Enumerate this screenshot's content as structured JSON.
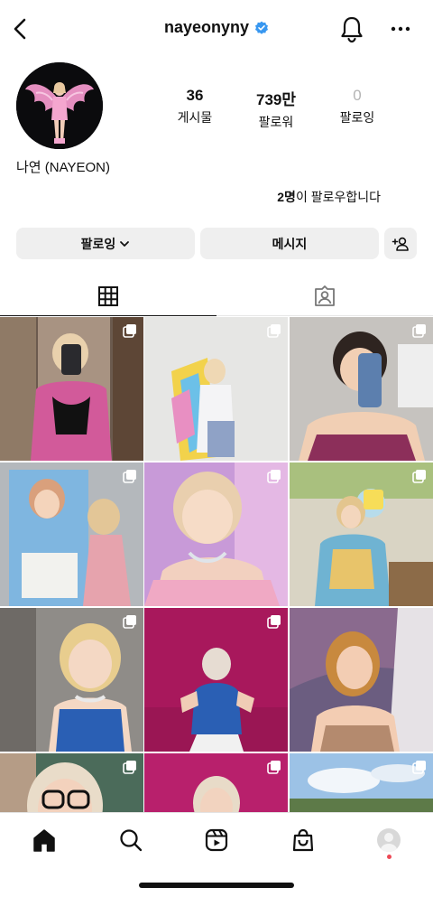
{
  "header": {
    "username": "nayeonyny",
    "verified": true,
    "back_icon": "chevron-left-icon",
    "bell_icon": "bell-icon",
    "more_icon": "more-horizontal-icon"
  },
  "profile": {
    "display_name": "나연 (NAYEON)",
    "stats": {
      "posts": {
        "value": "36",
        "label": "게시물"
      },
      "followers": {
        "value": "739만",
        "label": "팔로워"
      },
      "following": {
        "value": "0",
        "label": "팔로잉"
      }
    },
    "followed_by": {
      "count": "2명",
      "text": "이 팔로우합니다"
    }
  },
  "actions": {
    "following_label": "팔로잉",
    "message_label": "메시지",
    "add_user_icon": "add-user-icon"
  },
  "tabs": [
    {
      "name": "grid",
      "icon": "grid-icon",
      "active": true
    },
    {
      "name": "tagged",
      "icon": "tagged-person-icon",
      "active": false
    }
  ],
  "grid": {
    "tiles": [
      {
        "multi": true
      },
      {
        "multi": true
      },
      {
        "multi": true
      },
      {
        "multi": true
      },
      {
        "multi": true
      },
      {
        "multi": true
      },
      {
        "multi": true
      },
      {
        "multi": true
      },
      {
        "multi": false
      },
      {
        "multi": true
      },
      {
        "multi": true
      },
      {
        "multi": true
      }
    ]
  },
  "bottom_nav": [
    {
      "name": "home",
      "icon": "home-icon",
      "active": true
    },
    {
      "name": "search",
      "icon": "search-icon"
    },
    {
      "name": "reels",
      "icon": "reels-icon"
    },
    {
      "name": "shop",
      "icon": "shopping-bag-icon"
    },
    {
      "name": "profile",
      "icon": "profile-avatar-icon",
      "notification_dot": true
    }
  ],
  "colors": {
    "verified_blue": "#3897f0",
    "button_gray": "#efefef",
    "notification_red": "#ed4956",
    "text": "#111111"
  }
}
